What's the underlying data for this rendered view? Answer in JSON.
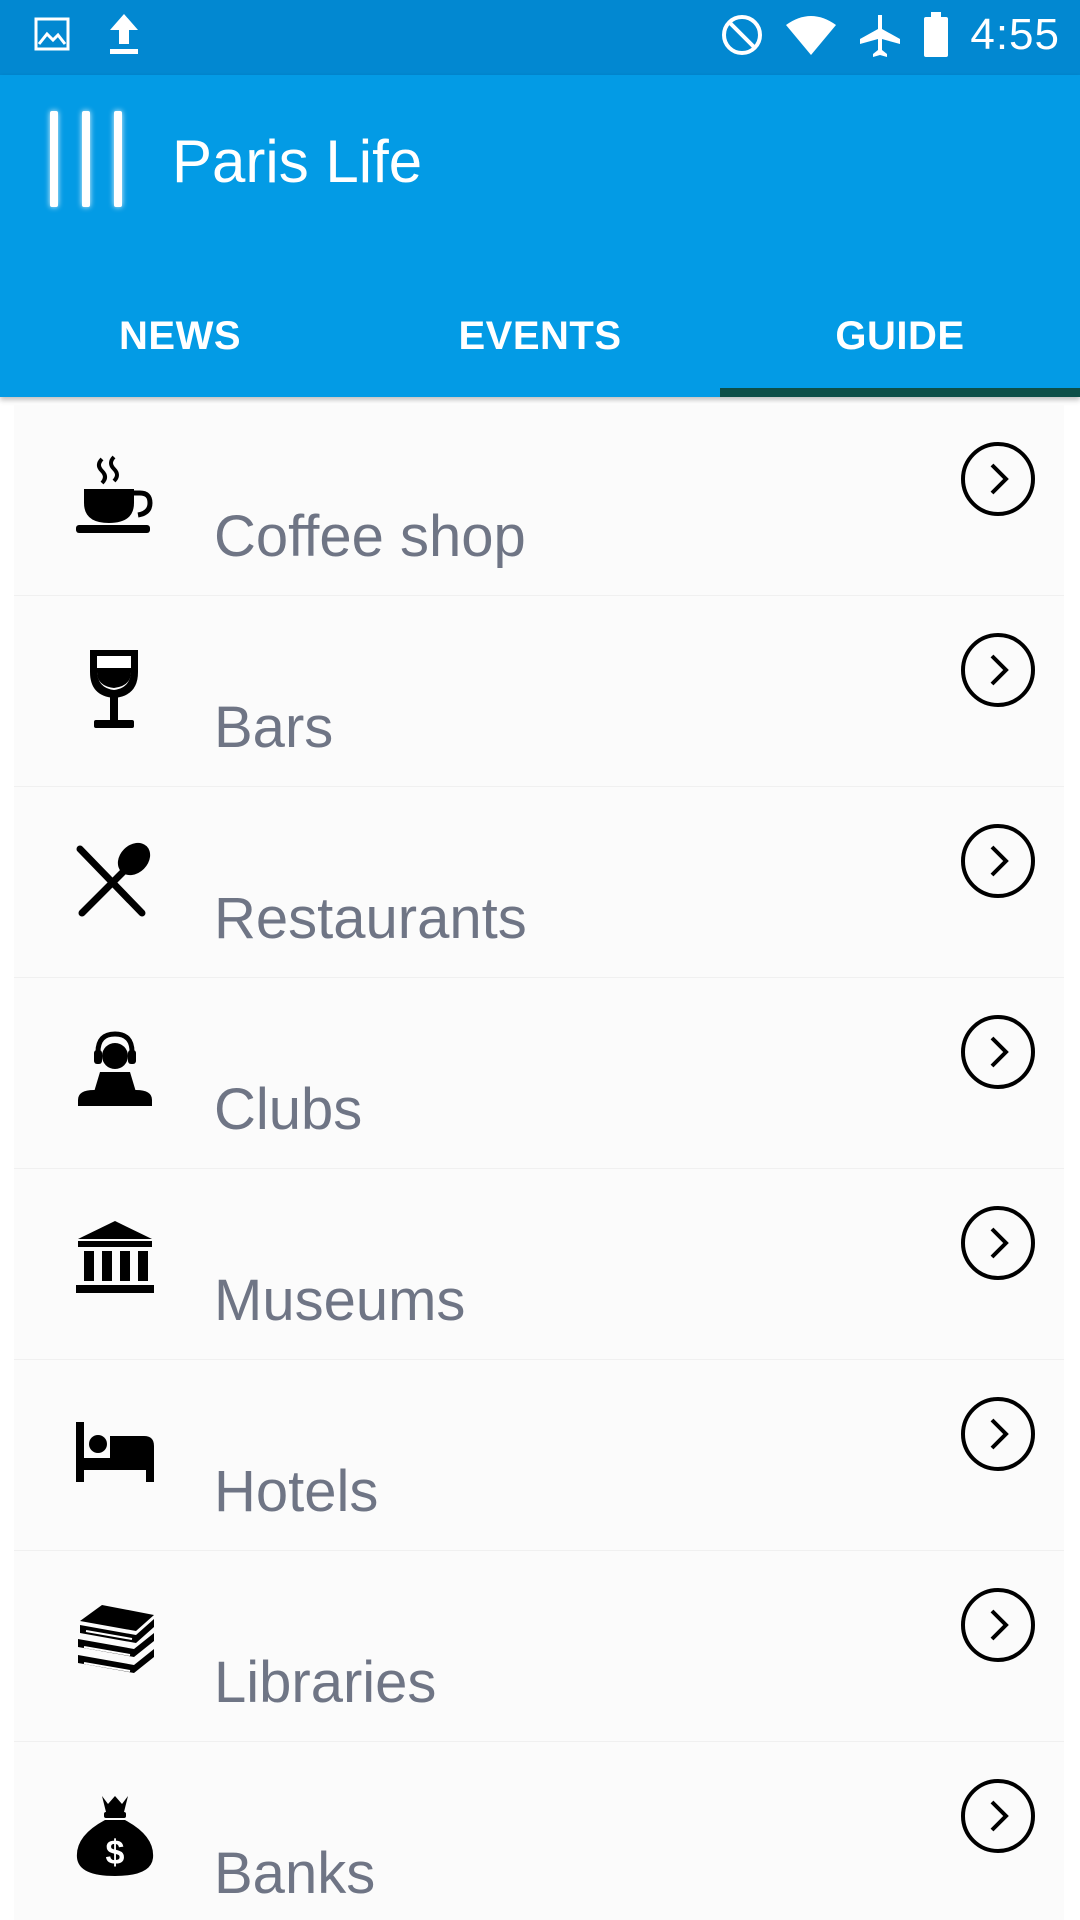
{
  "status_bar": {
    "time": "4:55",
    "left_icons": [
      "image-icon",
      "upload-icon"
    ],
    "right_icons": [
      "do-not-disturb-icon",
      "wifi-icon",
      "airplane-icon",
      "battery-icon"
    ]
  },
  "app_bar": {
    "title": "Paris Life",
    "menu_icon": "menu-icon",
    "color": "#039be5",
    "status_color": "#0288d1"
  },
  "tabs": [
    {
      "label": "NEWS",
      "active": false
    },
    {
      "label": "EVENTS",
      "active": false
    },
    {
      "label": "GUIDE",
      "active": true
    }
  ],
  "guide_list": {
    "items": [
      {
        "label": "Coffee shop",
        "icon": "coffee-cup-icon"
      },
      {
        "label": "Bars",
        "icon": "wine-glass-icon"
      },
      {
        "label": "Restaurants",
        "icon": "fork-spoon-icon"
      },
      {
        "label": "Clubs",
        "icon": "dj-headphones-icon"
      },
      {
        "label": "Museums",
        "icon": "museum-icon"
      },
      {
        "label": "Hotels",
        "icon": "bed-icon"
      },
      {
        "label": "Libraries",
        "icon": "books-icon"
      },
      {
        "label": "Banks",
        "icon": "money-bag-icon"
      }
    ],
    "arrow_icon": "chevron-right-circle-icon",
    "label_color": "#6f7585",
    "tab_indicator_color": "#0d4f48"
  }
}
